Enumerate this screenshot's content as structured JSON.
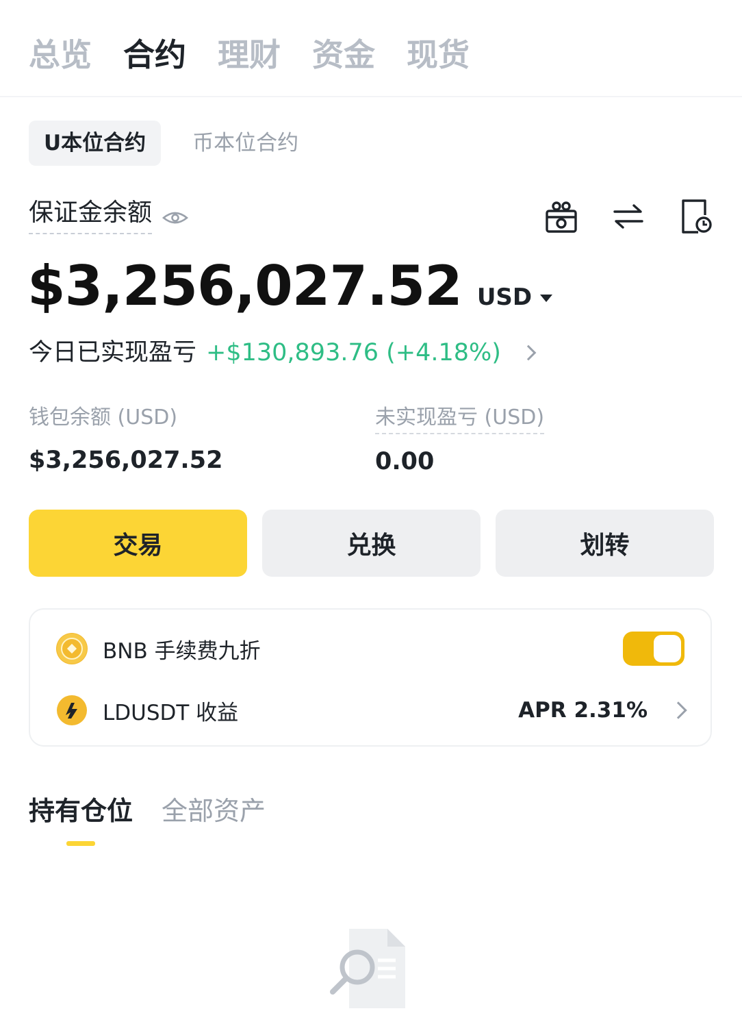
{
  "top_tabs": [
    {
      "label": "总览",
      "active": false
    },
    {
      "label": "合约",
      "active": true
    },
    {
      "label": "理财",
      "active": false
    },
    {
      "label": "资金",
      "active": false
    },
    {
      "label": "现货",
      "active": false
    }
  ],
  "sub_tabs": [
    {
      "label": "U本位合约",
      "active": true
    },
    {
      "label": "币本位合约",
      "active": false
    }
  ],
  "margin": {
    "label": "保证金余额",
    "balance": "$3,256,027.52",
    "currency": "USD"
  },
  "pnl": {
    "label": "今日已实现盈亏",
    "value": "+$130,893.76 (+4.18%)"
  },
  "stats": {
    "wallet_label": "钱包余额 (USD)",
    "wallet_value": "$3,256,027.52",
    "unrealized_label": "未实现盈亏 (USD)",
    "unrealized_value": "0.00"
  },
  "buttons": {
    "trade": "交易",
    "convert": "兑换",
    "transfer": "划转"
  },
  "card": {
    "bnb_label": "BNB 手续费九折",
    "bnb_toggle_on": true,
    "ldusdt_label": "LDUSDT 收益",
    "apr": "APR 2.31%"
  },
  "position_tabs": [
    {
      "label": "持有仓位",
      "active": true
    },
    {
      "label": "全部资产",
      "active": false
    }
  ],
  "colors": {
    "accent": "#fcd535",
    "positive": "#2ebd85",
    "toggle": "#f0b90b"
  },
  "icons": [
    "eye-icon",
    "gift-icon",
    "swap-icon",
    "history-icon",
    "bnb-icon",
    "ldusdt-icon",
    "chevron-right-icon",
    "empty-search-icon"
  ]
}
